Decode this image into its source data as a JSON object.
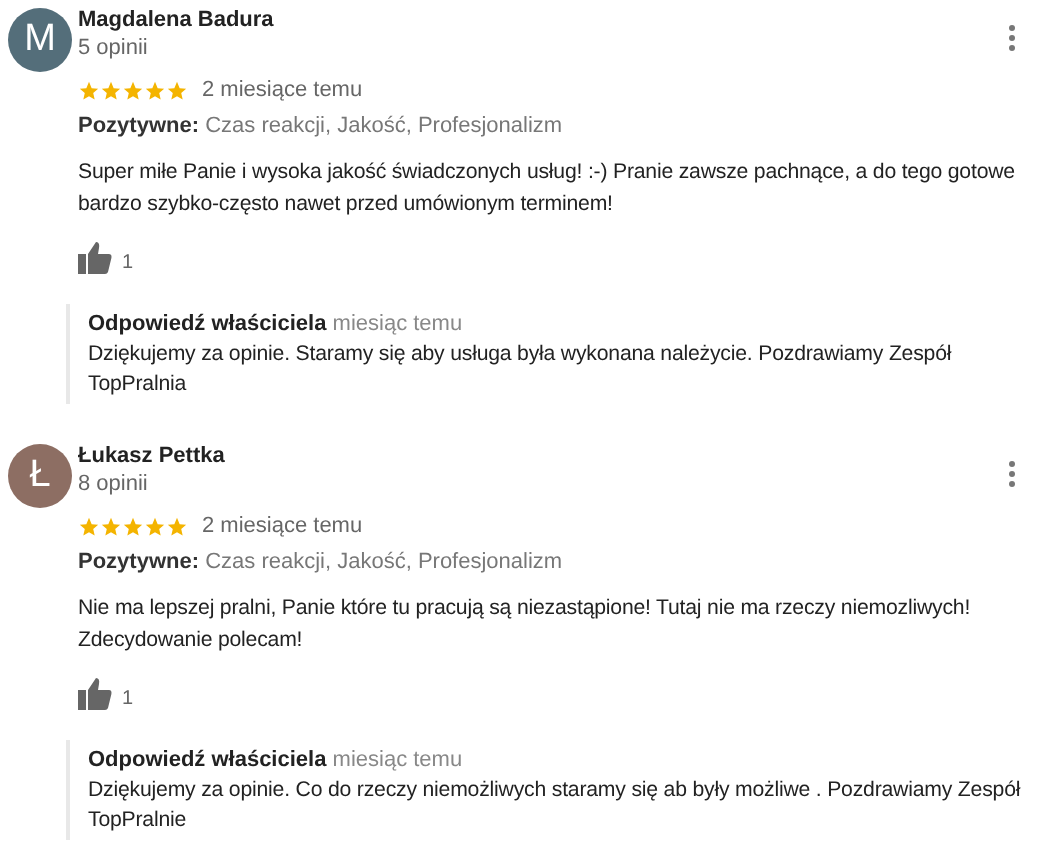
{
  "reviews": [
    {
      "initial": "M",
      "color": "#546e7a",
      "name": "Magdalena Badura",
      "count": "5 opinii",
      "stars": 5,
      "time": "2 miesiące temu",
      "tags_label": "Pozytywne:",
      "tags": "Czas reakcji, Jakość, Profesjonalizm",
      "text": "Super miłe Panie i wysoka jakość świadczonych usług! :-) Pranie zawsze pachnące, a do tego gotowe bardzo szybko-często nawet przed umówionym terminem!",
      "likes": "1",
      "reply": {
        "label": "Odpowiedź właściciela",
        "time": "miesiąc temu",
        "text": "Dziękujemy za opinie. Staramy się aby usługa była wykonana należycie. Pozdrawiamy Zespół TopPralnia"
      }
    },
    {
      "initial": "Ł",
      "color": "#8d6e63",
      "name": "Łukasz Pettka",
      "count": "8 opinii",
      "stars": 5,
      "time": "2 miesiące temu",
      "tags_label": "Pozytywne:",
      "tags": "Czas reakcji, Jakość, Profesjonalizm",
      "text": "Nie ma lepszej pralni, Panie które tu pracują są niezastąpione! Tutaj nie ma rzeczy niemozliwych! Zdecydowanie polecam!",
      "likes": "1",
      "reply": {
        "label": "Odpowiedź właściciela",
        "time": "miesiąc temu",
        "text": "Dziękujemy za opinie. Co do rzeczy niemożliwych staramy się ab były możliwe . Pozdrawiamy Zespół TopPralnie"
      }
    }
  ]
}
